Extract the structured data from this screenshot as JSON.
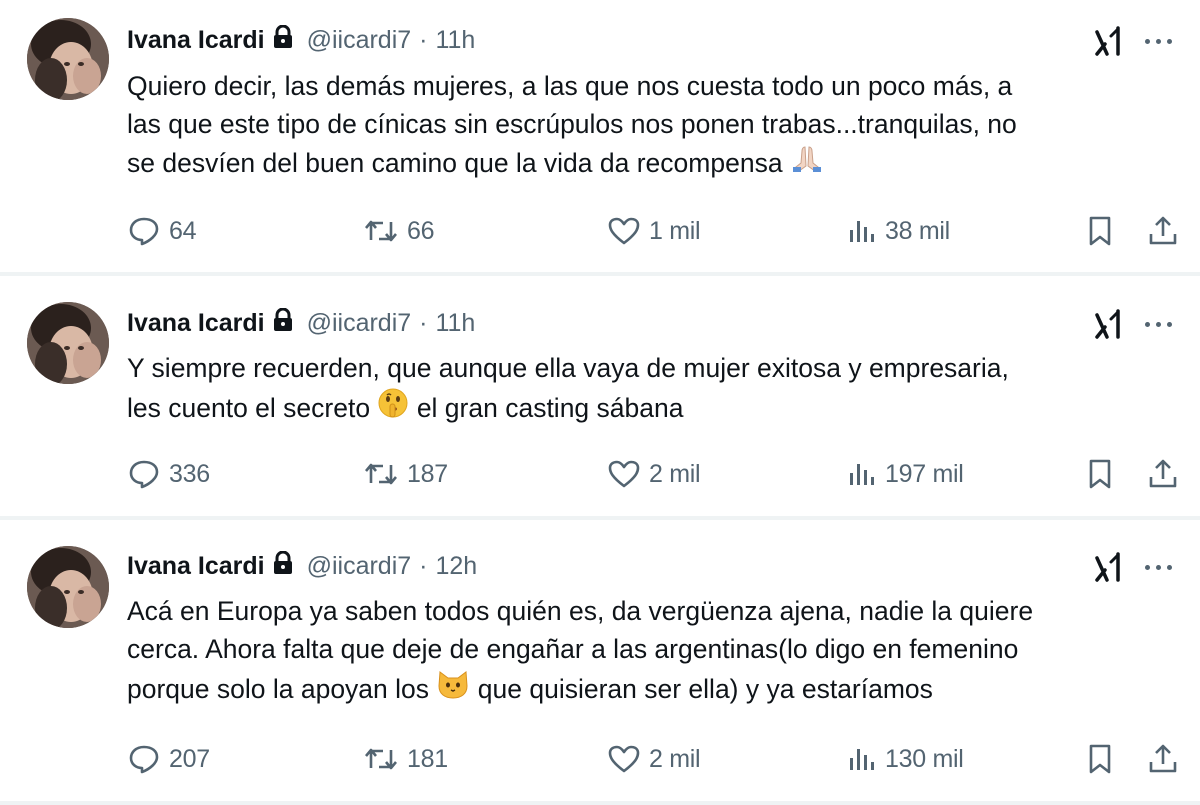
{
  "tweets": [
    {
      "author": "Ivana Icardi",
      "handle": "@iicardi7",
      "dot": "·",
      "time": "11h",
      "lines": [
        "Quiero decir, las demás mujeres, a las que nos cuesta todo un poco más, a",
        "las que este tipo de cínicas sin escrúpulos nos ponen trabas...tranquilas, no",
        "se desvíen del buen camino que la vida da recompensa"
      ],
      "emoji": "folded-hands-emoji",
      "stats": {
        "replies": "64",
        "reposts": "66",
        "likes": "1 mil",
        "views": "38 mil"
      }
    },
    {
      "author": "Ivana Icardi",
      "handle": "@iicardi7",
      "dot": "·",
      "time": "11h",
      "lines": [
        "Y siempre recuerden, que aunque ella vaya de mujer exitosa y empresaria,",
        "les cuento el secreto",
        "el gran casting sábana"
      ],
      "emoji": "shushing-face-emoji",
      "stats": {
        "replies": "336",
        "reposts": "187",
        "likes": "2 mil",
        "views": "197 mil"
      }
    },
    {
      "author": "Ivana Icardi",
      "handle": "@iicardi7",
      "dot": "·",
      "time": "12h",
      "lines": [
        "Acá en Europa ya saben todos quién es, da vergüenza ajena, nadie la quiere",
        "cerca. Ahora falta que deje de engañar a las argentinas(lo digo en femenino",
        "porque solo la apoyan los",
        "que quisieran ser ella) y ya estaríamos"
      ],
      "emoji": "cat-face-emoji",
      "stats": {
        "replies": "207",
        "reposts": "181",
        "likes": "2 mil",
        "views": "130 mil"
      }
    }
  ],
  "colors": {
    "text": "#0f1419",
    "secondary": "#536471",
    "divider": "#eff3f4"
  },
  "icons": [
    "lock-icon",
    "grok-icon",
    "more-icon",
    "reply-icon",
    "repost-icon",
    "like-icon",
    "views-icon",
    "bookmark-icon",
    "share-icon"
  ]
}
